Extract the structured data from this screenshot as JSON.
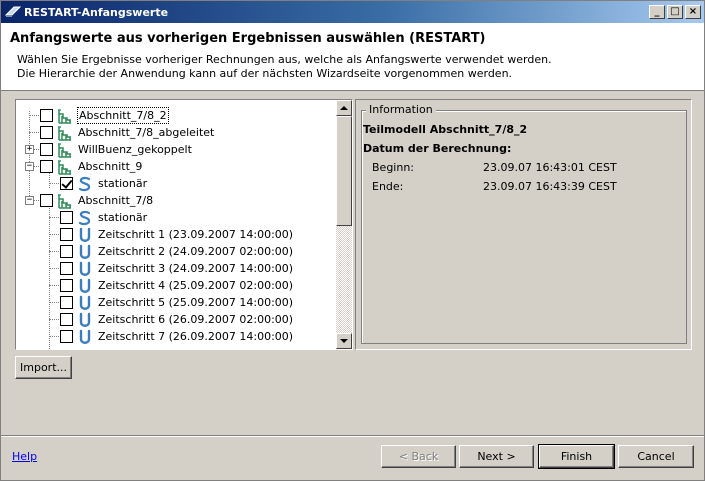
{
  "window": {
    "title": "RESTART-Anfangswerte",
    "minimize_glyph": "_",
    "maximize_glyph": "□",
    "close_glyph": "×"
  },
  "header": {
    "title": "Anfangswerte aus vorherigen Ergebnissen auswählen (RESTART)",
    "desc_line1": "Wählen Sie Ergebnisse vorheriger Rechnungen aus, welche als Anfangswerte verwendet werden.",
    "desc_line2": "Die Hierarchie der Anwendung kann auf der nächsten Wizardseite vorgenommen werden."
  },
  "tree": {
    "items": [
      {
        "label": "Abschnitt_7/8_2",
        "icon": "model-icon",
        "checked": false,
        "selected": true
      },
      {
        "label": "Abschnitt_7/8_abgeleitet",
        "icon": "model-icon",
        "checked": false
      },
      {
        "label": "WillBuenz_gekoppelt",
        "icon": "model-icon",
        "checked": false,
        "expander": "+"
      },
      {
        "label": "Abschnitt_9",
        "icon": "model-icon",
        "checked": false,
        "expander": "−"
      },
      {
        "label": "stationär",
        "icon": "stationary-icon",
        "checked": true
      },
      {
        "label": "Abschnitt_7/8",
        "icon": "model-icon",
        "checked": false,
        "expander": "−"
      },
      {
        "label": "stationär",
        "icon": "stationary-icon",
        "checked": false
      },
      {
        "label": "Zeitschritt 1 (23.09.2007 14:00:00)",
        "icon": "timestep-icon",
        "checked": false
      },
      {
        "label": "Zeitschritt 2 (24.09.2007 02:00:00)",
        "icon": "timestep-icon",
        "checked": false
      },
      {
        "label": "Zeitschritt 3 (24.09.2007 14:00:00)",
        "icon": "timestep-icon",
        "checked": false
      },
      {
        "label": "Zeitschritt 4 (25.09.2007 02:00:00)",
        "icon": "timestep-icon",
        "checked": false
      },
      {
        "label": "Zeitschritt 5 (25.09.2007 14:00:00)",
        "icon": "timestep-icon",
        "checked": false
      },
      {
        "label": "Zeitschritt 6 (26.09.2007 02:00:00)",
        "icon": "timestep-icon",
        "checked": false
      },
      {
        "label": "Zeitschritt 7 (26.09.2007 14:00:00)",
        "icon": "timestep-icon",
        "checked": false
      }
    ]
  },
  "info": {
    "legend": "Information",
    "model_title": "Teilmodell Abschnitt_7/8_2",
    "calc_date_heading": "Datum der Berechnung:",
    "begin_label": "Beginn:",
    "begin_value": "23.09.07 16:43:01 CEST",
    "end_label": "Ende:",
    "end_value": "23.09.07 16:43:39 CEST"
  },
  "buttons": {
    "import": "Import...",
    "help": "Help",
    "back": "< Back",
    "next": "Next >",
    "finish": "Finish",
    "cancel": "Cancel"
  }
}
